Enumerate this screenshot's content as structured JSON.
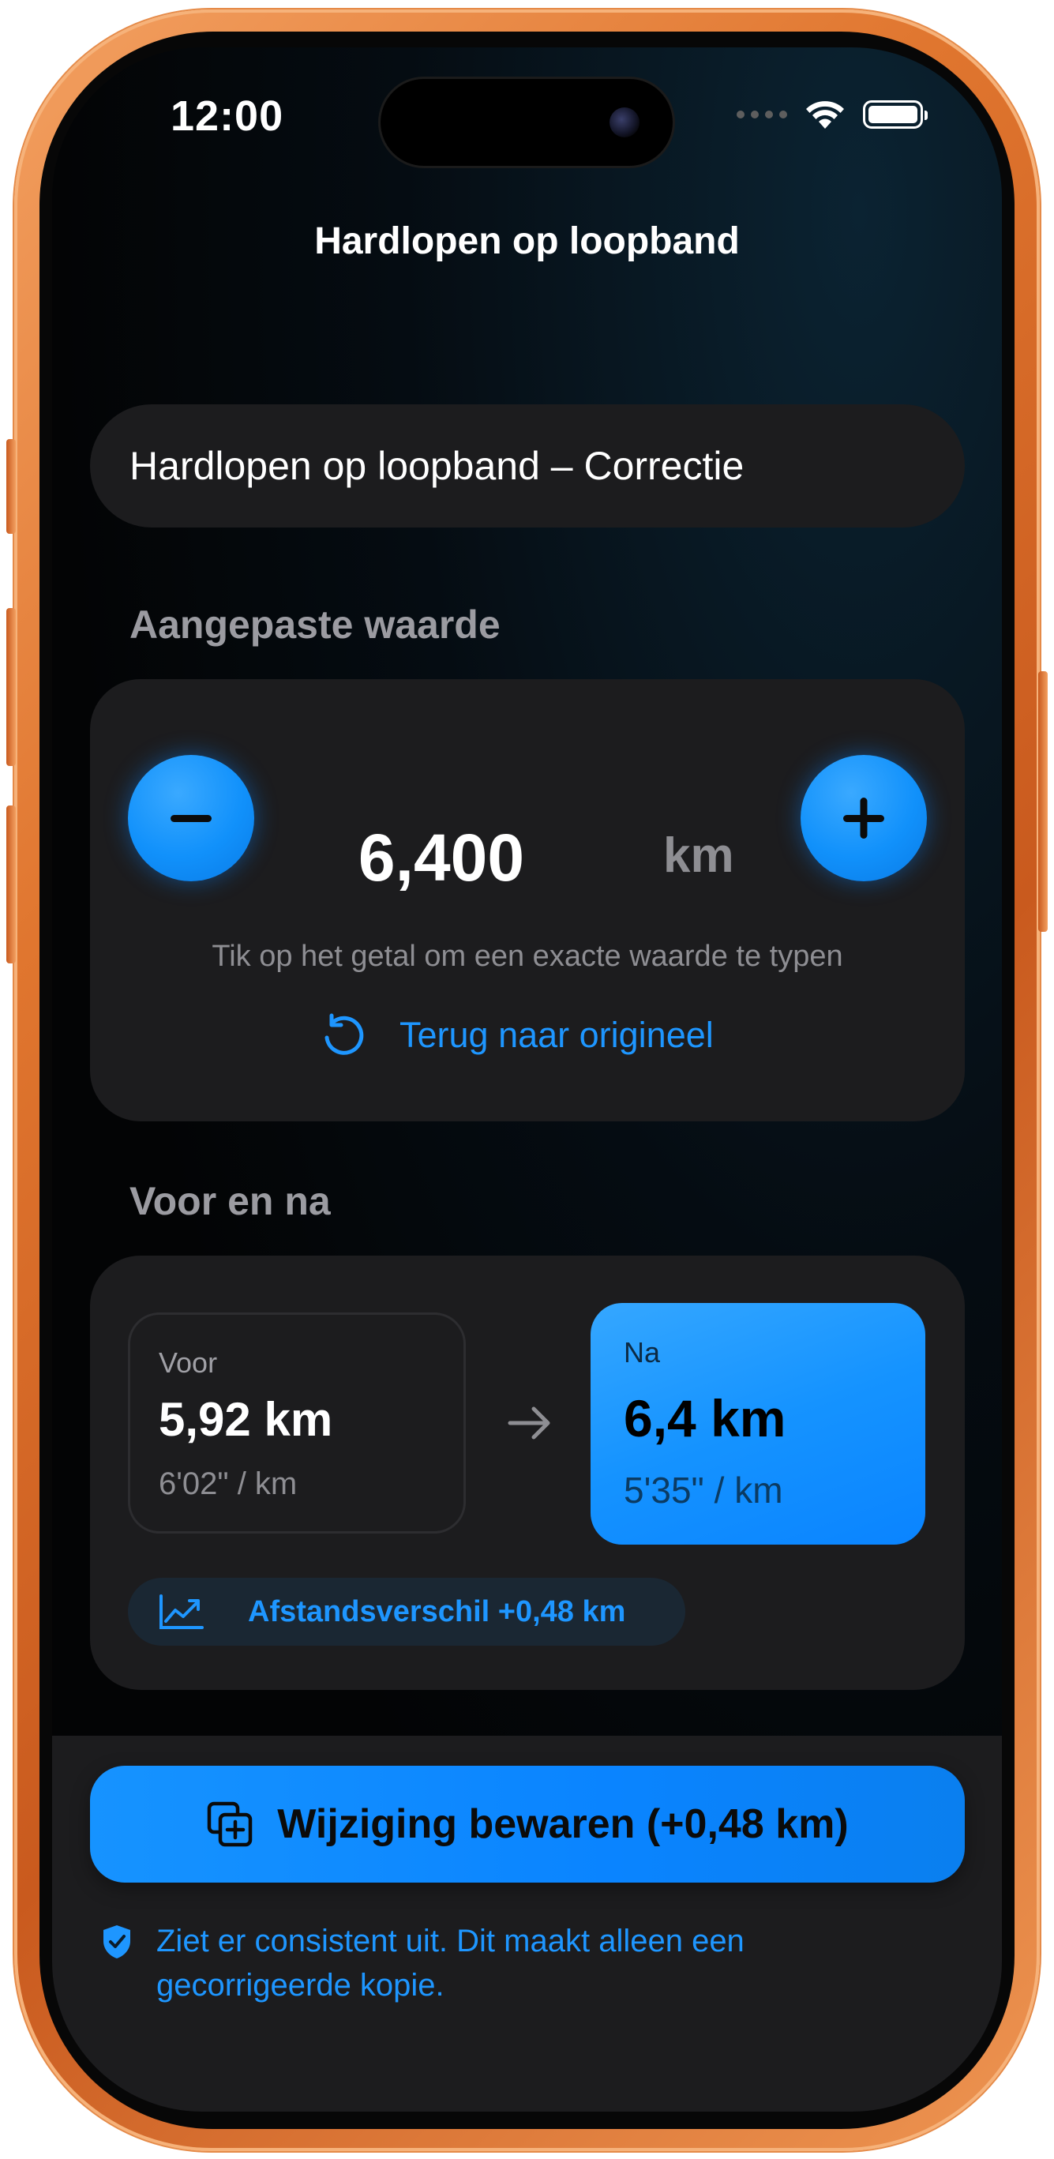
{
  "status_bar": {
    "time": "12:00"
  },
  "nav": {
    "title": "Hardlopen op loopband"
  },
  "workout_name": {
    "value": "Hardlopen op loopband – Correctie"
  },
  "adjusted": {
    "section_label": "Aangepaste waarde",
    "value": "6,400",
    "unit": "km",
    "hint": "Tik op het getal om een exacte waarde te typen",
    "revert_label": "Terug naar origineel"
  },
  "comparison": {
    "section_label": "Voor en na",
    "before": {
      "label": "Voor",
      "value": "5,92 km",
      "pace": "6'02\" / km"
    },
    "after": {
      "label": "Na",
      "value": "6,4 km",
      "pace": "5'35\" / km"
    },
    "difference": "Afstandsverschil +0,48 km"
  },
  "footer": {
    "save_label": "Wijziging bewaren (+0,48 km)",
    "info_text": "Ziet er consistent uit. Dit maakt alleen een gecorrigeerde kopie."
  },
  "colors": {
    "accent": "#0A84FF",
    "frame": "#E0762F",
    "card": "#1C1C1E"
  }
}
